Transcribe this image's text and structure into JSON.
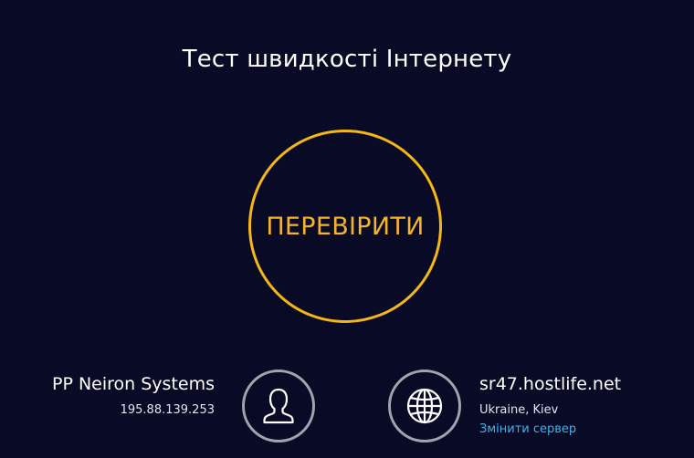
{
  "title": "Тест швидкості Інтернету",
  "go_button": {
    "label": "ПЕРЕВІРИТИ"
  },
  "provider": {
    "name": "PP Neiron Systems",
    "ip": "195.88.139.253"
  },
  "server": {
    "host": "sr47.hostlife.net",
    "location": "Ukraine, Kiev",
    "change_label": "Змінити сервер"
  },
  "icons": {
    "provider": "user-icon",
    "server": "globe-icon"
  },
  "colors": {
    "background": "#080a26",
    "accent": "#f4b814",
    "link": "#3ab4f0",
    "icon_ring": "#a3a3ad"
  }
}
